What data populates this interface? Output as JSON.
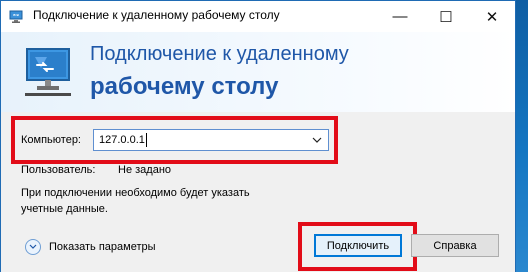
{
  "window": {
    "title": "Подключение к удаленному рабочему столу"
  },
  "caption": {
    "minimize": "—",
    "maximize": "☐",
    "close": "✕"
  },
  "header": {
    "line1": "Подключение к удаленному",
    "line2": "рабочему столу"
  },
  "form": {
    "computer_label": "Компьютер:",
    "computer_value": "127.0.0.1",
    "user_label": "Пользователь:",
    "user_value": "Не задано",
    "note": "При подключении необходимо будет указать учетные данные."
  },
  "footer": {
    "show_options": "Показать параметры",
    "connect": "Подключить",
    "help": "Справка"
  },
  "icons": {
    "app": "remote-desktop-icon",
    "monitor": "monitor-icon",
    "dropdown": "chevron-down-icon",
    "expand": "expand-options-icon"
  },
  "colors": {
    "heading": "#1f57a8",
    "highlight": "#e20c18",
    "accent": "#0078d7"
  }
}
